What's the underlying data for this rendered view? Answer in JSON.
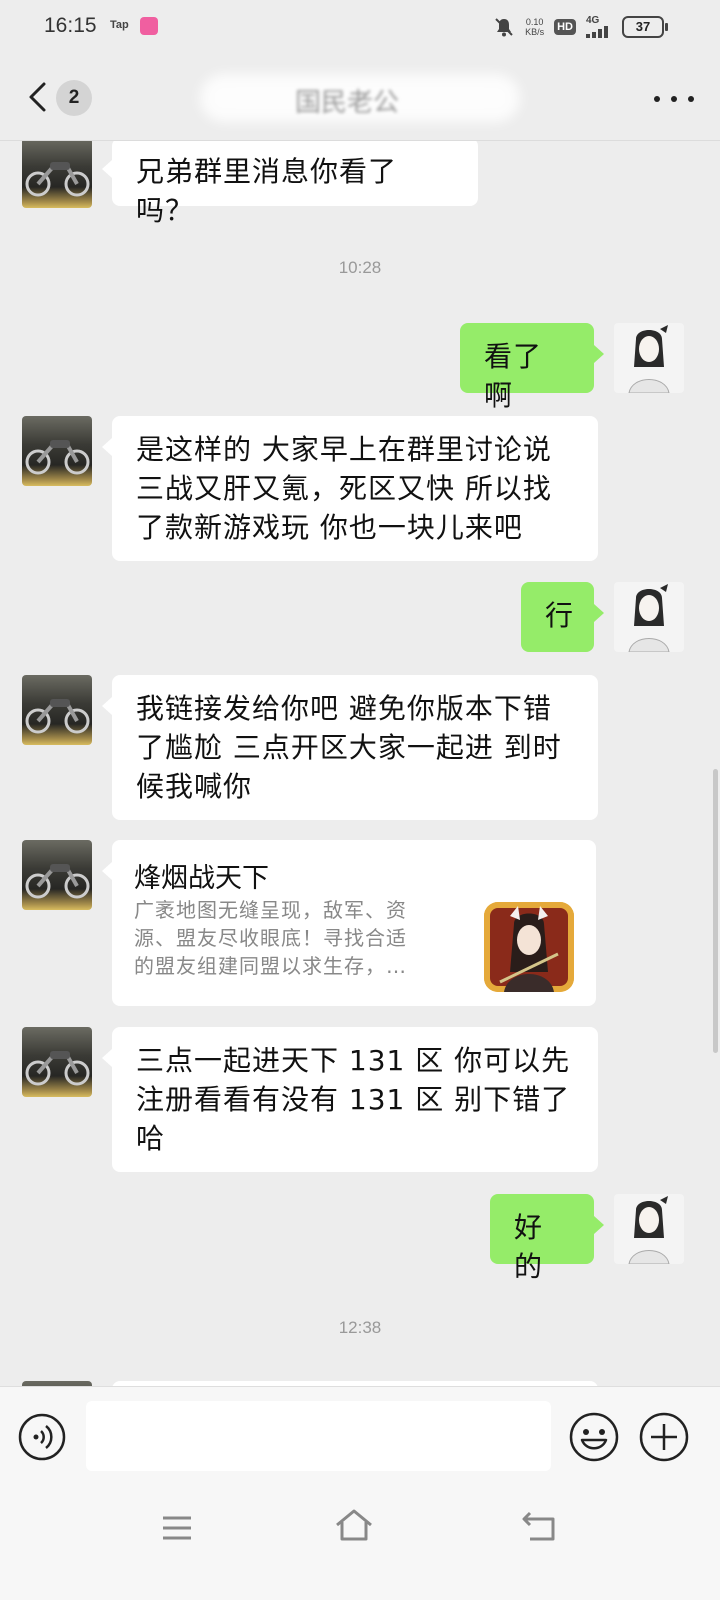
{
  "status_bar": {
    "time": "16:15",
    "tap_label": "Tap",
    "net_speed_value": "0.10",
    "net_speed_unit": "KB/s",
    "hd_label": "HD",
    "network_label": "4G",
    "battery": "37"
  },
  "header": {
    "unread_count": "2",
    "title": "国民老公"
  },
  "messages": [
    {
      "side": "left",
      "text": "兄弟群里消息你看了吗？"
    },
    {
      "type": "time",
      "text": "10:28"
    },
    {
      "side": "right",
      "text": "看了啊"
    },
    {
      "side": "left",
      "lines": [
        "是这样的 大家早上在群里讨论说",
        "三战又肝又氪，死区又快 所以找",
        "了款新游戏玩 你也一块儿来吧"
      ]
    },
    {
      "side": "right",
      "text": "行"
    },
    {
      "side": "left",
      "lines": [
        "我链接发给你吧 避免你版本下错",
        "了尴尬 三点开区大家一起进 到时",
        "候我喊你"
      ]
    },
    {
      "side": "left",
      "type": "card",
      "title": "烽烟战天下",
      "desc_lines": [
        "广袤地图无缝呈现，敌军、资",
        "源、盟友尽收眼底！寻找合适",
        "的盟友组建同盟以求生存，…"
      ]
    },
    {
      "side": "left",
      "lines": [
        "三点一起进天下 131 区 你可以先",
        "注册看看有没有 131 区 别下错了",
        "哈"
      ]
    },
    {
      "side": "right",
      "text": "好的"
    },
    {
      "type": "time",
      "text": "12:38"
    }
  ],
  "input_bar": {
    "placeholder": ""
  },
  "icons": {
    "back": "chevron-left-icon",
    "more": "more-dots-icon",
    "voice": "voice-icon",
    "emoji": "emoji-icon",
    "plus": "plus-icon",
    "nav_menu": "menu-icon",
    "nav_home": "home-icon",
    "nav_back": "back-icon"
  },
  "colors": {
    "background": "#ededed",
    "bubble_self": "#95ec69",
    "bubble_other": "#ffffff",
    "timestamp": "#999999"
  }
}
